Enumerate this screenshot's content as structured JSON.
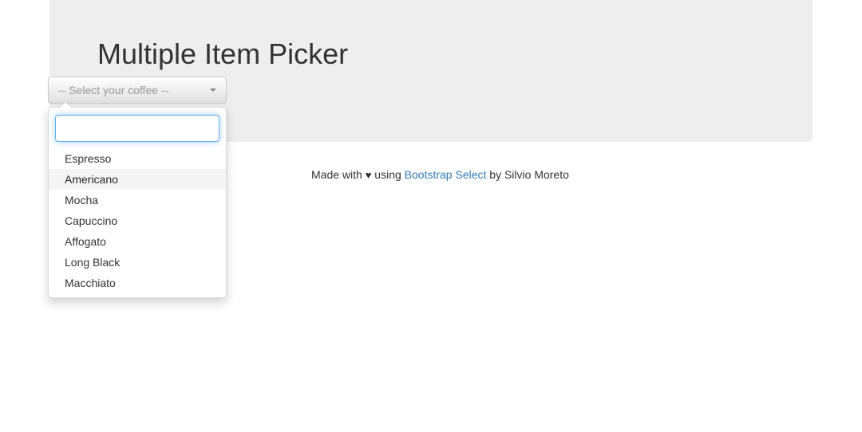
{
  "hero": {
    "title": "Multiple Item Picker"
  },
  "select": {
    "button_label": "-- Select your coffee --",
    "caret_icon": "caret-down-icon",
    "search_value": "",
    "search_placeholder": "",
    "is_open": true,
    "options": [
      {
        "label": "Espresso",
        "active": false
      },
      {
        "label": "Americano",
        "active": true
      },
      {
        "label": "Mocha",
        "active": false
      },
      {
        "label": "Capuccino",
        "active": false
      },
      {
        "label": "Affogato",
        "active": false
      },
      {
        "label": "Long Black",
        "active": false
      },
      {
        "label": "Macchiato",
        "active": false
      }
    ]
  },
  "footer": {
    "prefix": "Made with ",
    "heart": "♥",
    "middle": " using ",
    "link_label": "Bootstrap Select",
    "suffix": " by Silvio Moreto"
  },
  "colors": {
    "hero_background": "#eeeeee",
    "page_background": "#ffffff",
    "title_text": "#333333",
    "placeholder_text": "#999999",
    "link": "#337ab7",
    "focus_border": "#66afe9",
    "option_active_background": "#f5f5f5"
  }
}
